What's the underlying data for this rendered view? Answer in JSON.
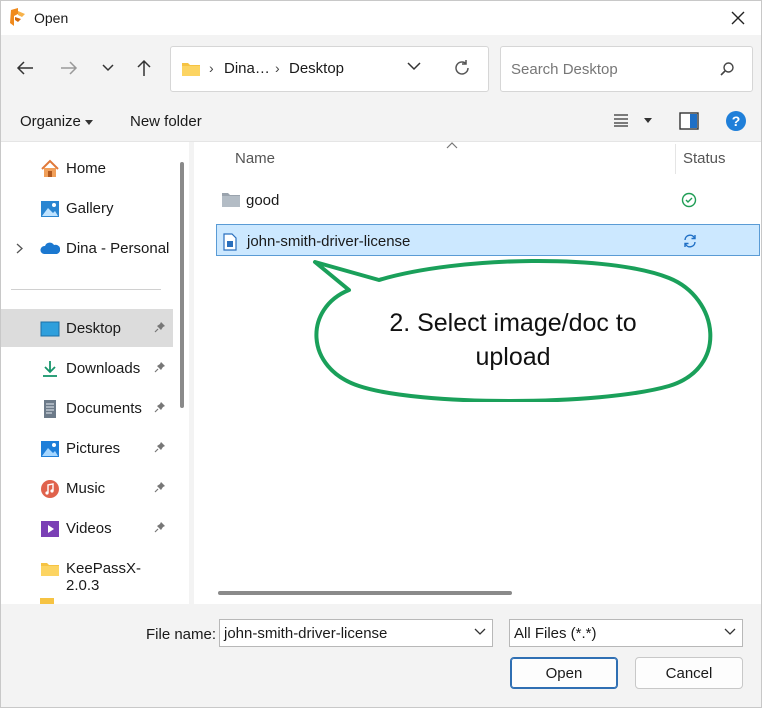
{
  "window": {
    "title": "Open"
  },
  "address": {
    "crumbs": [
      "Dina…",
      "Desktop"
    ]
  },
  "search": {
    "placeholder": "Search Desktop"
  },
  "toolbar": {
    "organize": "Organize",
    "new_folder": "New folder"
  },
  "nav": {
    "top": [
      {
        "label": "Home",
        "icon": "home-icon"
      },
      {
        "label": "Gallery",
        "icon": "gallery-icon"
      },
      {
        "label": "Dina - Personal",
        "icon": "onedrive-icon"
      }
    ],
    "quick": [
      {
        "label": "Desktop",
        "icon": "desktop-icon",
        "pinned": true,
        "selected": true
      },
      {
        "label": "Downloads",
        "icon": "download-icon",
        "pinned": true
      },
      {
        "label": "Documents",
        "icon": "documents-icon",
        "pinned": true
      },
      {
        "label": "Pictures",
        "icon": "pictures-icon",
        "pinned": true
      },
      {
        "label": "Music",
        "icon": "music-icon",
        "pinned": true
      },
      {
        "label": "Videos",
        "icon": "videos-icon",
        "pinned": true
      },
      {
        "label": "KeePassX-2.0.3",
        "icon": "folder-icon",
        "pinned": false
      }
    ]
  },
  "columns": {
    "name": "Name",
    "status": "Status"
  },
  "files": [
    {
      "name": "good",
      "type": "folder",
      "status": "synced"
    },
    {
      "name": "john-smith-driver-license",
      "type": "file",
      "status": "syncing",
      "selected": true
    }
  ],
  "callout": {
    "line1": "2. Select image/doc to",
    "line2": "upload",
    "color": "#1aa05a"
  },
  "footer": {
    "file_name_label": "File name:",
    "file_name_value": "john-smith-driver-license",
    "file_type": "All Files (*.*)",
    "open": "Open",
    "cancel": "Cancel"
  }
}
